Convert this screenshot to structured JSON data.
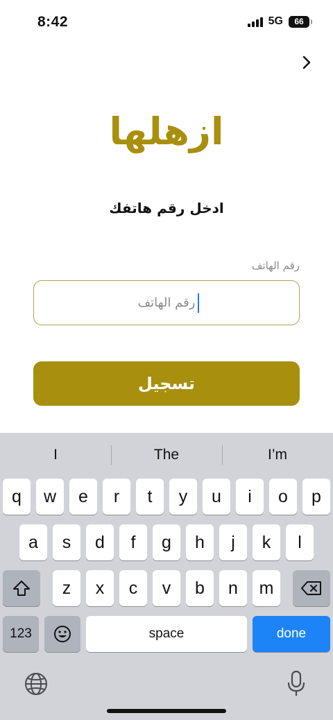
{
  "status": {
    "time": "8:42",
    "network": "5G",
    "battery": "66"
  },
  "screen": {
    "brand": "ازهلها",
    "subtitle": "ادخل رقم هاتفك",
    "phone_label": "رقم الهاتف",
    "phone_placeholder": "رقم الهاتف",
    "register_label": "تسجيل"
  },
  "keyboard": {
    "suggestions": [
      "I",
      "The",
      "I’m"
    ],
    "row1": [
      "q",
      "w",
      "e",
      "r",
      "t",
      "y",
      "u",
      "i",
      "o",
      "p"
    ],
    "row2": [
      "a",
      "s",
      "d",
      "f",
      "g",
      "h",
      "j",
      "k",
      "l"
    ],
    "row3": [
      "z",
      "x",
      "c",
      "v",
      "b",
      "n",
      "m"
    ],
    "num_label": "123",
    "space_label": "space",
    "done_label": "done"
  },
  "colors": {
    "accent": "#a98f0e",
    "done": "#1c84f6",
    "keyboard_bg": "#d1d3d9"
  }
}
